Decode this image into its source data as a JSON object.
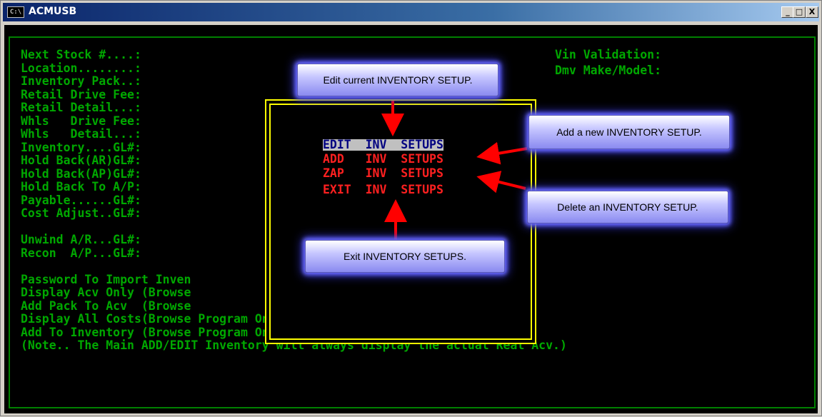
{
  "window": {
    "icon_text": "C:\\",
    "title": "ACMUSB",
    "minimize_label": "_",
    "maximize_label": "□",
    "close_label": "X"
  },
  "terminal": {
    "left_lines": [
      "Next Stock #....:",
      "Location........:",
      "Inventory Pack..:",
      "Retail Drive Fee:",
      "Retail Detail...:",
      "Whls   Drive Fee:",
      "Whls   Detail...:",
      "Inventory....GL#:",
      "Hold Back(AR)GL#:",
      "Hold Back(AP)GL#:",
      "Hold Back To A/P:",
      "Payable......GL#:",
      "Cost Adjust..GL#:",
      "",
      "Unwind A/R...GL#:",
      "Recon  A/P...GL#:",
      "",
      "Password To Import Inven",
      "Display Acv Only (Browse",
      "Add Pack To Acv  (Browse",
      "Display All Costs(Browse Program Only):",
      "Add To Inventory (Browse Program Only):",
      "(Note.. The Main ADD/EDIT Inventory will always display the actual Real Acv.)"
    ],
    "right_lines": [
      "Vin Validation:",
      "Dmv Make/Model:"
    ]
  },
  "menu": {
    "items": [
      "EDIT  INV  SETUPS",
      "ADD   INV  SETUPS",
      "ZAP   INV  SETUPS",
      "EXIT  INV  SETUPS"
    ],
    "selected_index": 0
  },
  "callouts": {
    "edit": "Edit current INVENTORY SETUP.",
    "add": "Add a new INVENTORY SETUP.",
    "delete": "Delete an INVENTORY SETUP.",
    "exit": "Exit INVENTORY SETUPS."
  },
  "colors": {
    "terminal_text": "#00a800",
    "menu_text": "#ff2020",
    "menu_border": "#ffff00",
    "arrow": "#ff0000",
    "callout_glow": "#6a6aff"
  }
}
